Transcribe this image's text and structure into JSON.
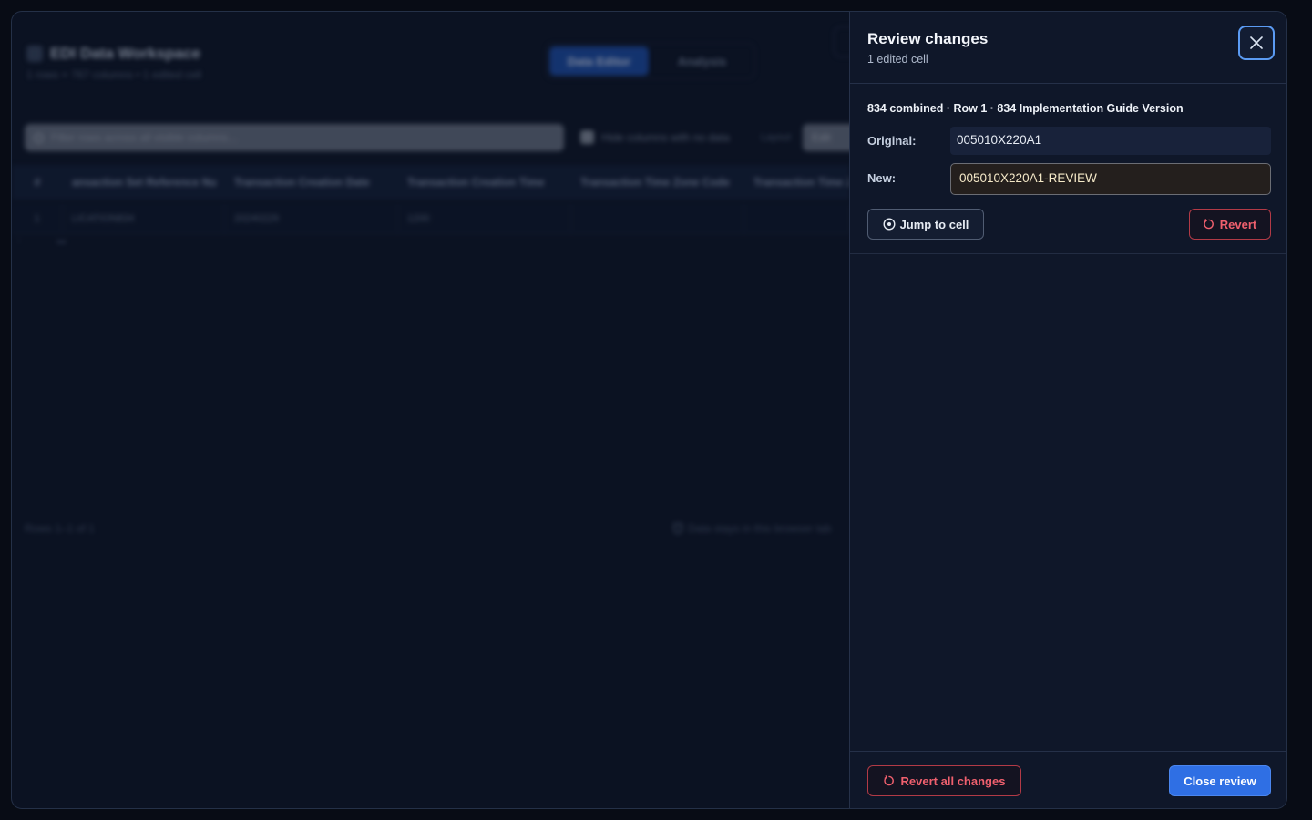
{
  "workspace": {
    "title": "EDI Data Workspace",
    "subtitle": "1 rows × 767 columns • 1 edited cell",
    "tabs": [
      {
        "label": "Data Editor",
        "active": true
      },
      {
        "label": "Analysis",
        "active": false
      }
    ],
    "search": {
      "placeholder": "Filter rows across all visible columns..."
    },
    "hide_empty_label": "Hide columns with no data",
    "layout": {
      "label": "Layout",
      "value": "Edit"
    },
    "table": {
      "columns": [
        "#",
        "ansaction Set Reference Nu",
        "Transaction Creation Date",
        "Transaction Creation Time",
        "Transaction Time Zone Code",
        "Transaction Time Z"
      ],
      "rows": [
        [
          "1",
          "LICATION834",
          "20240229",
          "1200",
          "",
          ""
        ]
      ]
    },
    "footer_rows": "Rows 1–1 of 1",
    "footer_privacy": "Data stays in this browser tab"
  },
  "drawer": {
    "title": "Review changes",
    "subtitle": "1 edited cell",
    "change": {
      "heading": "834 combined · Row 1 · 834 Implementation Guide Version",
      "original_label": "Original:",
      "original_value": "005010X220A1",
      "new_label": "New:",
      "new_value": "005010X220A1-REVIEW",
      "jump_label": "Jump to cell",
      "revert_label": "Revert"
    },
    "footer": {
      "revert_all_label": "Revert all changes",
      "close_review_label": "Close review"
    }
  },
  "colors": {
    "background": "#080c15",
    "drawer": "#0f1729",
    "accent": "#2f6fe4",
    "danger": "#f0606e",
    "new_value_bg": "#241f1d"
  }
}
